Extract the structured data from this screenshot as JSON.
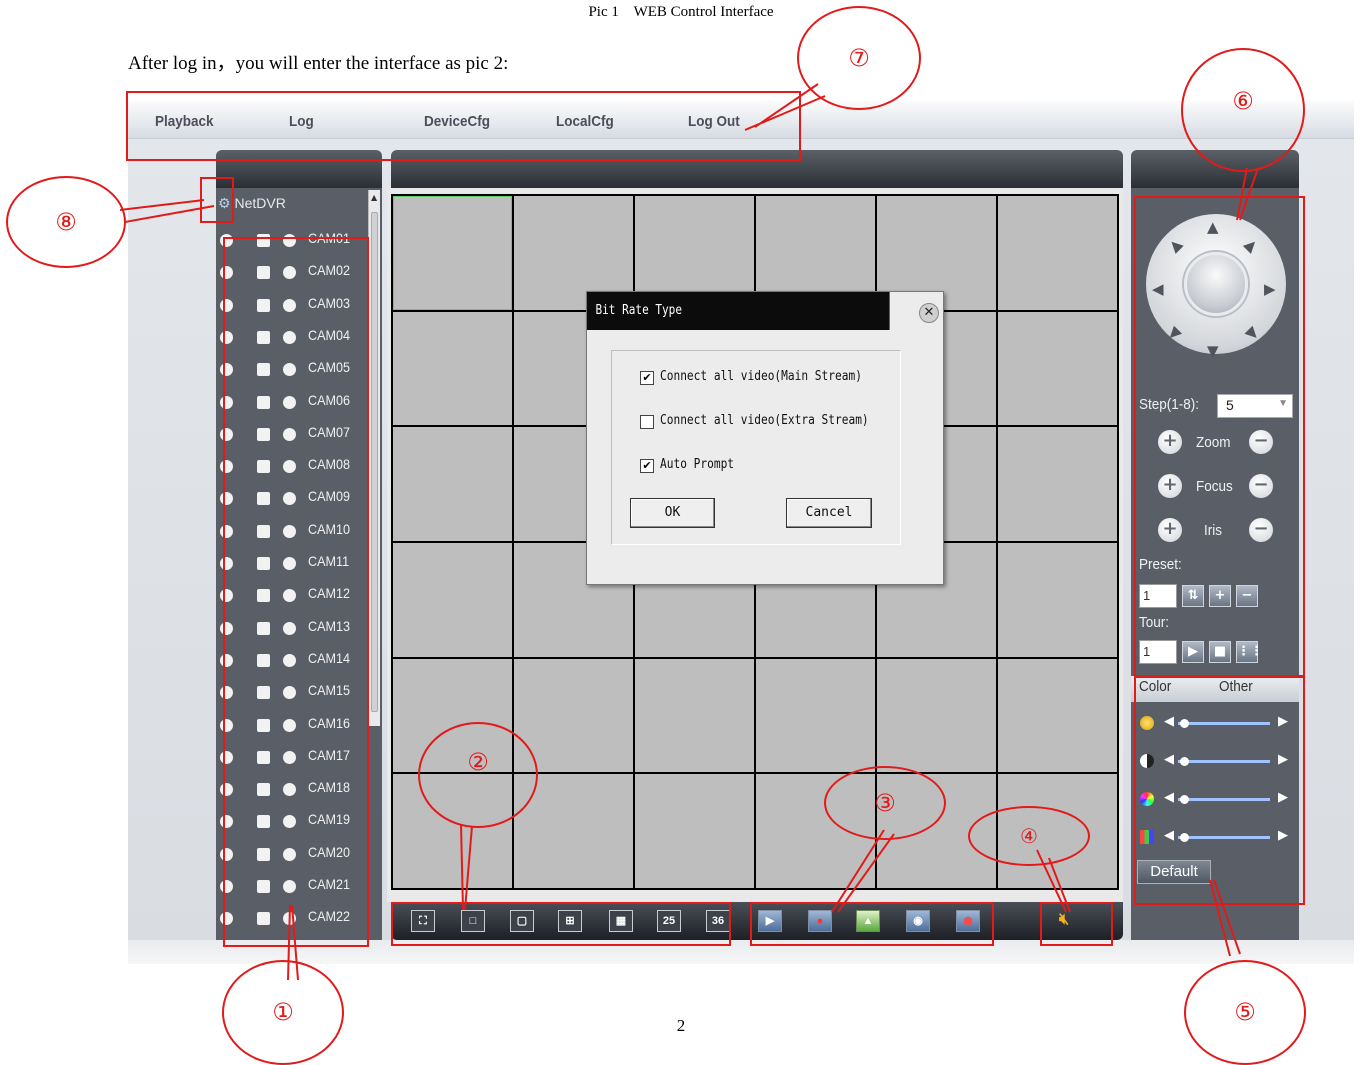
{
  "caption": "Pic 1    WEB Control Interface",
  "intro": "After log in，you will enter the interface as pic 2:",
  "page_number": "2",
  "menu": [
    "Playback",
    "Log",
    "DeviceCfg",
    "LocalCfg",
    "Log Out"
  ],
  "tree_root": "NetDVR",
  "cameras": [
    "CAM01",
    "CAM02",
    "CAM03",
    "CAM04",
    "CAM05",
    "CAM06",
    "CAM07",
    "CAM08",
    "CAM09",
    "CAM10",
    "CAM11",
    "CAM12",
    "CAM13",
    "CAM14",
    "CAM15",
    "CAM16",
    "CAM17",
    "CAM18",
    "CAM19",
    "CAM20",
    "CAM21",
    "CAM22"
  ],
  "toolbar": {
    "layout_25": "25",
    "layout_36": "36"
  },
  "ptz": {
    "step_label": "Step(1-8):",
    "step_value": "5",
    "zoom_label": "Zoom",
    "focus_label": "Focus",
    "iris_label": "Iris",
    "preset_label": "Preset:",
    "preset_value": "1",
    "tour_label": "Tour:",
    "tour_value": "1"
  },
  "tabs": {
    "color": "Color",
    "other": "Other"
  },
  "default_button": "Default",
  "dialog": {
    "title": "Bit Rate Type",
    "options": [
      {
        "label": "Connect all video(Main Stream)",
        "checked": true
      },
      {
        "label": "Connect all video(Extra Stream)",
        "checked": false
      },
      {
        "label": "Auto Prompt",
        "checked": true
      }
    ],
    "ok": "OK",
    "cancel": "Cancel"
  },
  "callouts": [
    "①",
    "②",
    "③",
    "④",
    "⑤",
    "⑥",
    "⑦",
    "⑧"
  ],
  "colors": {
    "annotation": "#e21a1a",
    "panel": "#5a5f67",
    "grid_cell": "#bebebe"
  }
}
